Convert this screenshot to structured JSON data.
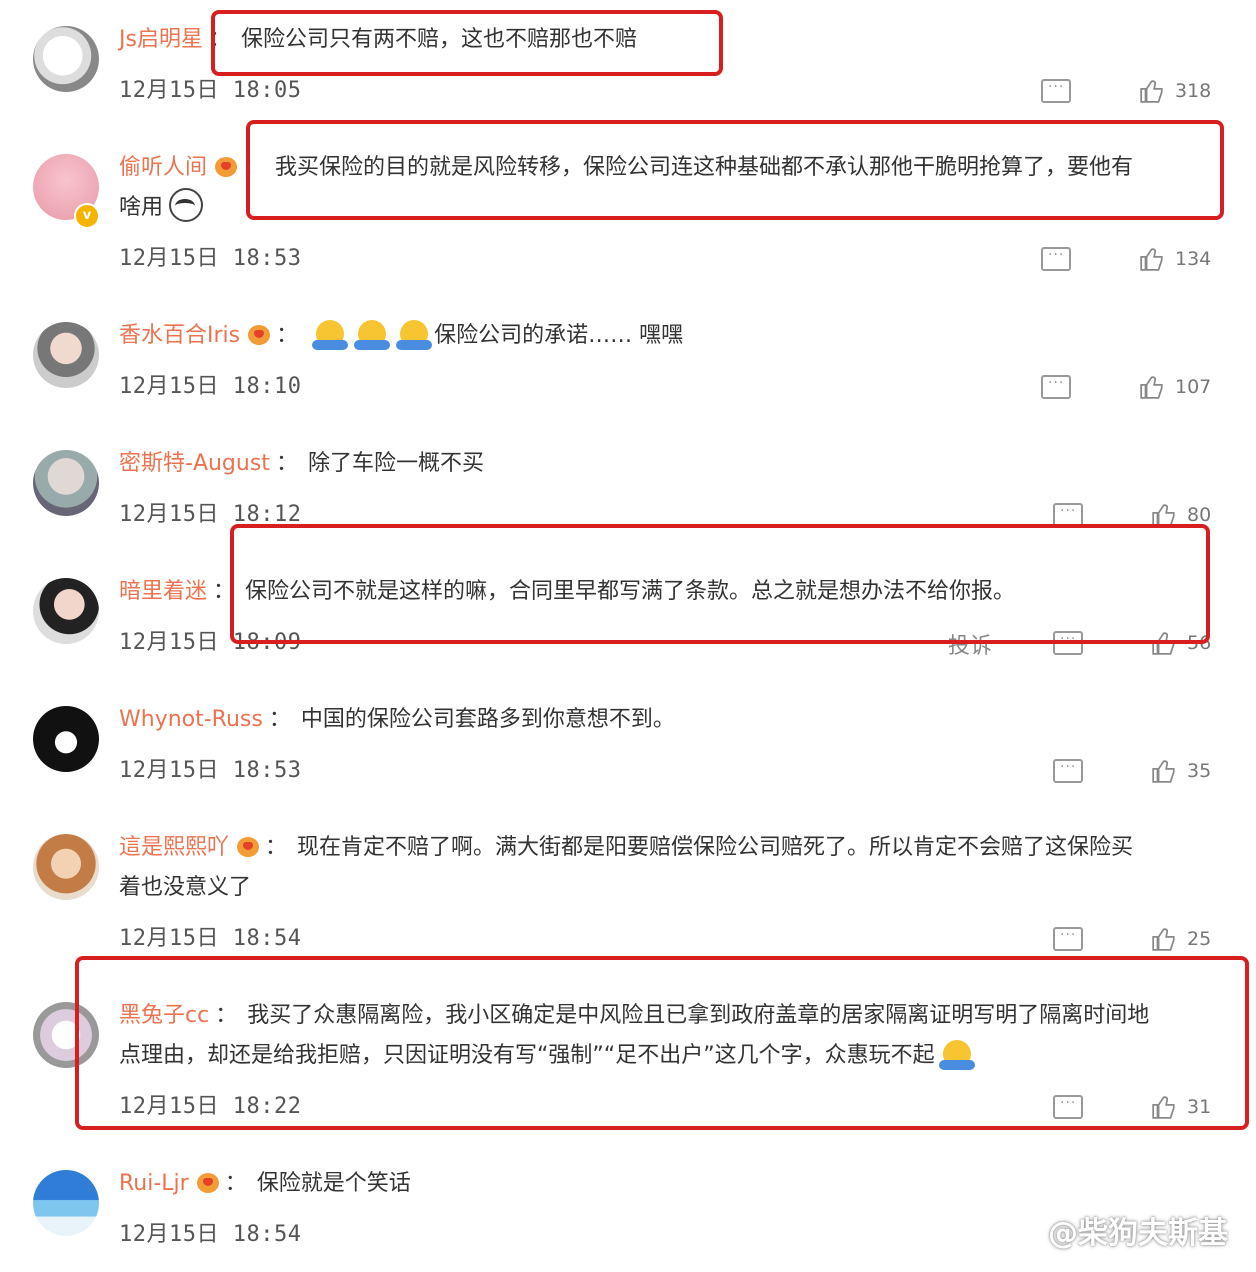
{
  "comments": [
    {
      "user": "Js启明星",
      "text": "保险公司只有两不赔，这也不赔那也不赔",
      "time": "12月15日 18:05",
      "likes": "318"
    },
    {
      "user": "偷听人间",
      "text": "我买保险的目的就是风险转移，保险公司连这种基础都不承认那他干脆明抢算了，要他有",
      "text2": "啥用",
      "time": "12月15日 18:53",
      "likes": "134"
    },
    {
      "user": "香水百合Iris",
      "text": "保险公司的承诺…… 嘿嘿",
      "time": "12月15日 18:10",
      "likes": "107"
    },
    {
      "user": "密斯特-August",
      "text": "除了车险一概不买",
      "time": "12月15日 18:12",
      "likes": "80"
    },
    {
      "user": "暗里着迷",
      "text": "保险公司不就是这样的嘛，合同里早都写满了条款。总之就是想办法不给你报。",
      "time": "12月15日 18:09",
      "likes": "56"
    },
    {
      "user": "Whynot-Russ",
      "text": "中国的保险公司套路多到你意想不到。",
      "time": "12月15日 18:53",
      "likes": "35"
    },
    {
      "user": "這是熙熙吖",
      "text": "现在肯定不赔了啊。满大街都是阳要赔偿保险公司赔死了。所以肯定不会赔了这保险买",
      "text2": "着也没意义了",
      "time": "12月15日 18:54",
      "likes": "25"
    },
    {
      "user": "黑兔子cc",
      "text": "我买了众惠隔离险，我小区确定是中风险且已拿到政府盖章的居家隔离证明写明了隔离时间地",
      "text2": "点理由，却还是给我拒赔，只因证明没有写“强制”“足不出户”这几个字，众惠玩不起",
      "time": "12月15日 18:22",
      "likes": "31"
    },
    {
      "user": "Rui-Ljr",
      "text": "保险就是个笑话",
      "time": "12月15日 18:54",
      "likes": ""
    }
  ],
  "report_label": "投诉",
  "colon": "：",
  "watermark": "@柴狗夫斯基",
  "colors": {
    "username": "#eb7350",
    "highlight_box": "#d81f1f"
  }
}
